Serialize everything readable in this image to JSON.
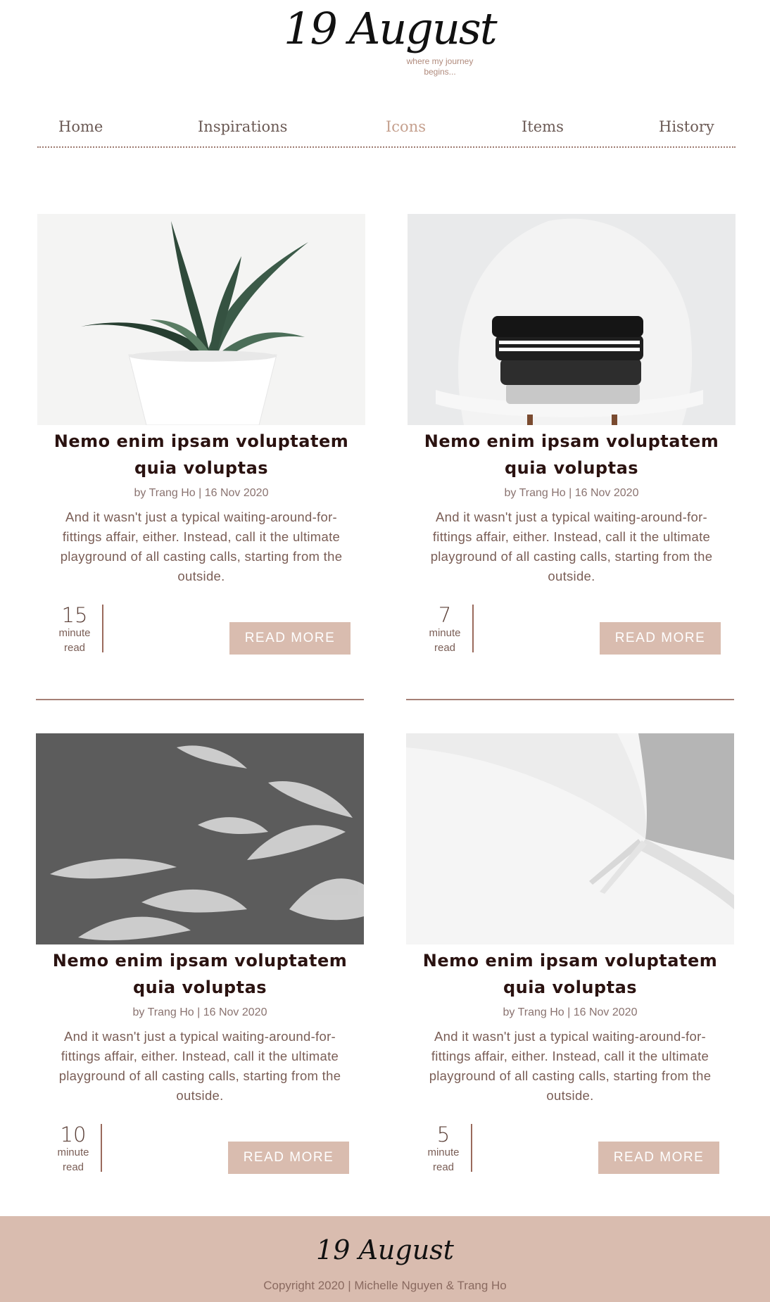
{
  "header": {
    "logo_text": "19 August",
    "tagline": "where my journey begins..."
  },
  "nav": {
    "items": [
      {
        "label": "Home"
      },
      {
        "label": "Inspirations"
      },
      {
        "label": "Icons",
        "active": true
      },
      {
        "label": "Items"
      },
      {
        "label": "History"
      }
    ]
  },
  "posts": [
    {
      "image": "potted-plant-photo",
      "title": "Nemo enim ipsam voluptatem quia voluptas",
      "meta": "by Trang Ho | 16 Nov 2020",
      "excerpt": "And it wasn't just a typical waiting-around-for-fittings affair, either. Instead, call it the ultimate playground of all casting calls, starting from the outside.",
      "read_minutes": "15",
      "read_unit_1": "minute",
      "read_unit_2": "read",
      "button": "READ MORE"
    },
    {
      "image": "folded-clothes-on-chair-photo",
      "title": "Nemo enim ipsam voluptatem quia voluptas",
      "meta": "by Trang Ho | 16 Nov 2020",
      "excerpt": "And it wasn't just a typical waiting-around-for-fittings affair, either. Instead, call it the ultimate playground of all casting calls, starting from the outside.",
      "read_minutes": "7",
      "read_unit_1": "minute",
      "read_unit_2": "read",
      "button": "READ MORE"
    },
    {
      "image": "leaf-shadows-photo",
      "title": "Nemo enim ipsam voluptatem quia voluptas",
      "meta": "by Trang Ho | 16 Nov 2020",
      "excerpt": "And it wasn't just a typical waiting-around-for-fittings affair, either. Instead, call it the ultimate playground of all casting calls, starting from the outside.",
      "read_minutes": "10",
      "read_unit_1": "minute",
      "read_unit_2": "read",
      "button": "READ MORE"
    },
    {
      "image": "open-book-photo",
      "title": "Nemo enim ipsam voluptatem quia voluptas",
      "meta": "by Trang Ho | 16 Nov 2020",
      "excerpt": "And it wasn't just a typical waiting-around-for-fittings affair, either. Instead, call it the ultimate playground of all casting calls, starting from the outside.",
      "read_minutes": "5",
      "read_unit_1": "minute",
      "read_unit_2": "read",
      "button": "READ MORE"
    }
  ],
  "footer": {
    "logo_text": "19 August",
    "copyright": "Copyright 2020 | Michelle Nguyen & Trang Ho"
  },
  "colors": {
    "accent": "#d9bcaf",
    "nav_active": "#c5a08e",
    "title": "#2a1210",
    "divider": "#a68076"
  }
}
